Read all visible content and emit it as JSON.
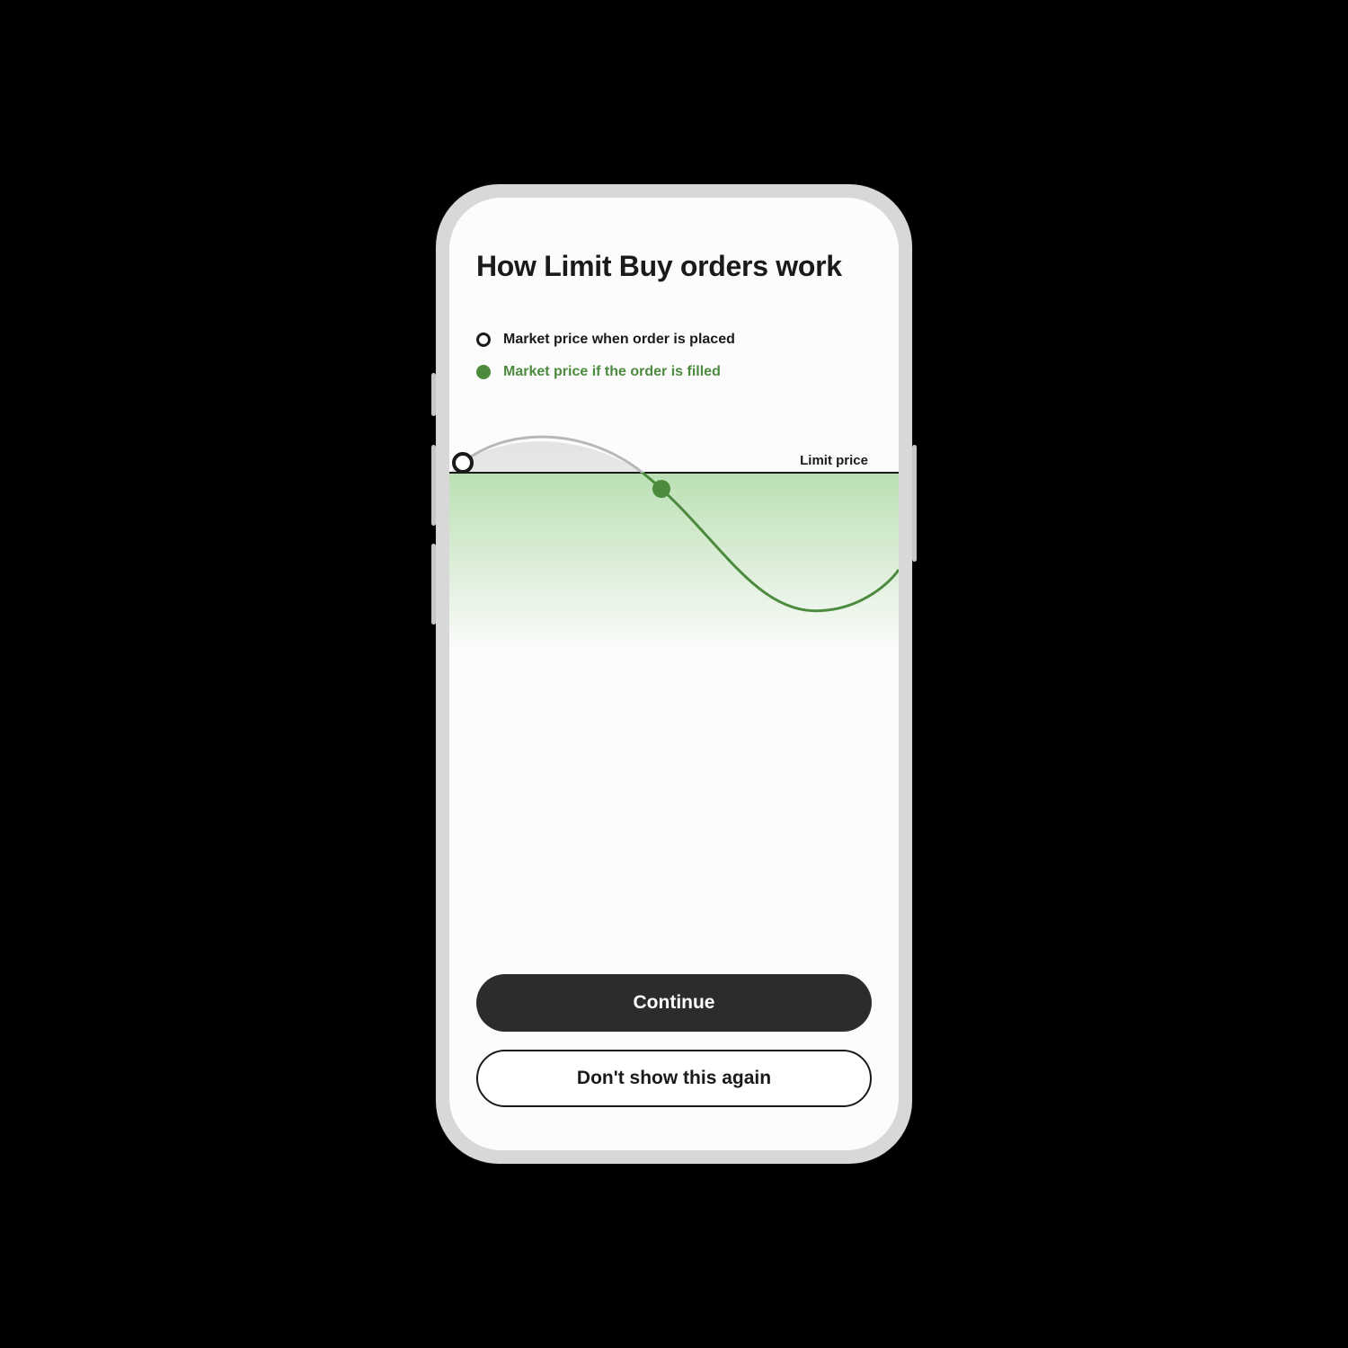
{
  "title": "How Limit Buy orders work",
  "legend": {
    "placed": "Market price when order is placed",
    "filled": "Market price if the order is filled"
  },
  "chart": {
    "limit_label": "Limit price",
    "colors": {
      "accent": "#4c8a3e",
      "neutral": "#b8b8b8",
      "line": "#1a1a1a"
    }
  },
  "buttons": {
    "continue": "Continue",
    "dont_show": "Don't show this again"
  }
}
